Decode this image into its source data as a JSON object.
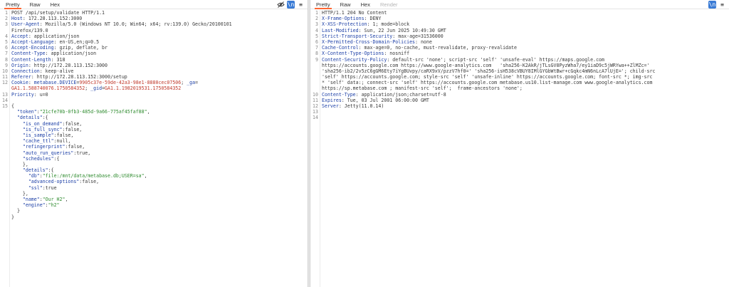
{
  "request": {
    "tabs": [
      {
        "label": "Pretty",
        "active": true
      },
      {
        "label": "Raw"
      },
      {
        "label": "Hex"
      }
    ],
    "tools": [
      {
        "name": "hide-icon",
        "glyph": ""
      },
      {
        "name": "newline-icon",
        "glyph": "\\n"
      },
      {
        "name": "menu-icon",
        "glyph": "≡"
      }
    ]
  },
  "response": {
    "tabs": [
      {
        "label": "Pretty",
        "active": true
      },
      {
        "label": "Raw"
      },
      {
        "label": "Hex"
      },
      {
        "label": "Render",
        "disabled": true
      }
    ]
  },
  "request_lines": [
    {
      "n": "1",
      "parts": [
        {
          "c": "v",
          "t": "POST /api/setup/validate HTTP/1.1"
        }
      ]
    },
    {
      "n": "2",
      "parts": [
        {
          "c": "h",
          "t": "Host"
        },
        {
          "c": "v",
          "t": ": 172.28.113.152:3000"
        }
      ]
    },
    {
      "n": "3",
      "parts": [
        {
          "c": "h",
          "t": "User-Agent"
        },
        {
          "c": "v",
          "t": ": Mozilla/5.0 (Windows NT 10.0; Win64; x64; rv:139.0) Gecko/20100101"
        }
      ]
    },
    {
      "n": "",
      "parts": [
        {
          "c": "v",
          "t": "Firefox/139.0"
        }
      ]
    },
    {
      "n": "4",
      "parts": [
        {
          "c": "h",
          "t": "Accept"
        },
        {
          "c": "v",
          "t": ": application/json"
        }
      ]
    },
    {
      "n": "5",
      "parts": [
        {
          "c": "h",
          "t": "Accept-Language"
        },
        {
          "c": "v",
          "t": ": en-US,en;q=0.5"
        }
      ]
    },
    {
      "n": "6",
      "parts": [
        {
          "c": "h",
          "t": "Accept-Encoding"
        },
        {
          "c": "v",
          "t": ": gzip, deflate, br"
        }
      ]
    },
    {
      "n": "7",
      "parts": [
        {
          "c": "h",
          "t": "Content-Type"
        },
        {
          "c": "v",
          "t": ": application/json"
        }
      ]
    },
    {
      "n": "8",
      "parts": [
        {
          "c": "h",
          "t": "Content-Length"
        },
        {
          "c": "v",
          "t": ": 318"
        }
      ]
    },
    {
      "n": "9",
      "parts": [
        {
          "c": "h",
          "t": "Origin"
        },
        {
          "c": "v",
          "t": ": http://172.28.113.152:3000"
        }
      ]
    },
    {
      "n": "10",
      "parts": [
        {
          "c": "h",
          "t": "Connection"
        },
        {
          "c": "v",
          "t": ": keep-alive"
        }
      ]
    },
    {
      "n": "11",
      "parts": [
        {
          "c": "h",
          "t": "Referer"
        },
        {
          "c": "v",
          "t": ": http://172.28.113.152:3000/setup"
        }
      ]
    },
    {
      "n": "12",
      "parts": [
        {
          "c": "h",
          "t": "Cookie"
        },
        {
          "c": "v",
          "t": ": "
        },
        {
          "c": "ck",
          "t": "metabase.DEVICE"
        },
        {
          "c": "v",
          "t": "="
        },
        {
          "c": "cv",
          "t": "9905c37e-59de-42a3-98e1-8880cec07506"
        },
        {
          "c": "v",
          "t": "; "
        },
        {
          "c": "ck",
          "t": "_ga"
        },
        {
          "c": "v",
          "t": "="
        }
      ]
    },
    {
      "n": "",
      "parts": [
        {
          "c": "cv",
          "t": "GA1.1.588740076.1750584352"
        },
        {
          "c": "v",
          "t": "; "
        },
        {
          "c": "ck",
          "t": "_gid"
        },
        {
          "c": "v",
          "t": "="
        },
        {
          "c": "cv",
          "t": "GA1.1.1982019531.1750584352"
        }
      ]
    },
    {
      "n": "13",
      "parts": [
        {
          "c": "h",
          "t": "Priority"
        },
        {
          "c": "v",
          "t": ": u=0"
        }
      ]
    },
    {
      "n": "14",
      "parts": []
    },
    {
      "n": "15",
      "parts": [
        {
          "c": "jp",
          "t": "{"
        }
      ]
    },
    {
      "n": "",
      "parts": [
        {
          "c": "jp",
          "t": "  "
        },
        {
          "c": "jk",
          "t": "\"token\""
        },
        {
          "c": "jp",
          "t": ":"
        },
        {
          "c": "js",
          "t": "\"21cfe70b-0fb3-485d-9a66-775af45faf88\""
        },
        {
          "c": "jp",
          "t": ","
        }
      ]
    },
    {
      "n": "",
      "parts": [
        {
          "c": "jp",
          "t": "  "
        },
        {
          "c": "jk",
          "t": "\"details\""
        },
        {
          "c": "jp",
          "t": ":{"
        }
      ]
    },
    {
      "n": "",
      "parts": [
        {
          "c": "jp",
          "t": "    "
        },
        {
          "c": "jk",
          "t": "\"is_on_demand\""
        },
        {
          "c": "jp",
          "t": ":false,"
        }
      ]
    },
    {
      "n": "",
      "parts": [
        {
          "c": "jp",
          "t": "    "
        },
        {
          "c": "jk",
          "t": "\"is_full_sync\""
        },
        {
          "c": "jp",
          "t": ":false,"
        }
      ]
    },
    {
      "n": "",
      "parts": [
        {
          "c": "jp",
          "t": "    "
        },
        {
          "c": "jk",
          "t": "\"is_sample\""
        },
        {
          "c": "jp",
          "t": ":false,"
        }
      ]
    },
    {
      "n": "",
      "parts": [
        {
          "c": "jp",
          "t": "    "
        },
        {
          "c": "jk",
          "t": "\"cache_ttl\""
        },
        {
          "c": "jp",
          "t": ":null,"
        }
      ]
    },
    {
      "n": "",
      "parts": [
        {
          "c": "jp",
          "t": "    "
        },
        {
          "c": "jk",
          "t": "\"refingerprint\""
        },
        {
          "c": "jp",
          "t": ":false,"
        }
      ]
    },
    {
      "n": "",
      "parts": [
        {
          "c": "jp",
          "t": "    "
        },
        {
          "c": "jk",
          "t": "\"auto_run_queries\""
        },
        {
          "c": "jp",
          "t": ":true,"
        }
      ]
    },
    {
      "n": "",
      "parts": [
        {
          "c": "jp",
          "t": "    "
        },
        {
          "c": "jk",
          "t": "\"schedules\""
        },
        {
          "c": "jp",
          "t": ":{"
        }
      ]
    },
    {
      "n": "",
      "parts": [
        {
          "c": "jp",
          "t": "    },"
        }
      ]
    },
    {
      "n": "",
      "parts": [
        {
          "c": "jp",
          "t": "    "
        },
        {
          "c": "jk",
          "t": "\"details\""
        },
        {
          "c": "jp",
          "t": ":{"
        }
      ]
    },
    {
      "n": "",
      "parts": [
        {
          "c": "jp",
          "t": "      "
        },
        {
          "c": "jk",
          "t": "\"db\""
        },
        {
          "c": "jp",
          "t": ":"
        },
        {
          "c": "js",
          "t": "\"file:/mnt/data/metabase.db;USER=sa\""
        },
        {
          "c": "jp",
          "t": ","
        }
      ]
    },
    {
      "n": "",
      "parts": [
        {
          "c": "jp",
          "t": "      "
        },
        {
          "c": "jk",
          "t": "\"advanced-options\""
        },
        {
          "c": "jp",
          "t": ":false,"
        }
      ]
    },
    {
      "n": "",
      "parts": [
        {
          "c": "jp",
          "t": "      "
        },
        {
          "c": "jk",
          "t": "\"ssl\""
        },
        {
          "c": "jp",
          "t": ":true"
        }
      ]
    },
    {
      "n": "",
      "parts": [
        {
          "c": "jp",
          "t": "    },"
        }
      ]
    },
    {
      "n": "",
      "parts": [
        {
          "c": "jp",
          "t": "    "
        },
        {
          "c": "jk",
          "t": "\"name\""
        },
        {
          "c": "jp",
          "t": ":"
        },
        {
          "c": "js",
          "t": "\"Our H2\""
        },
        {
          "c": "jp",
          "t": ","
        }
      ]
    },
    {
      "n": "",
      "parts": [
        {
          "c": "jp",
          "t": "    "
        },
        {
          "c": "jk",
          "t": "\"engine\""
        },
        {
          "c": "jp",
          "t": ":"
        },
        {
          "c": "js",
          "t": "\"h2\""
        }
      ]
    },
    {
      "n": "",
      "parts": [
        {
          "c": "jp",
          "t": "  }"
        }
      ]
    },
    {
      "n": "",
      "parts": [
        {
          "c": "jp",
          "t": "}"
        }
      ]
    }
  ],
  "response_lines": [
    {
      "n": "1",
      "parts": [
        {
          "c": "v",
          "t": "HTTP/1.1 204 No Content"
        }
      ]
    },
    {
      "n": "2",
      "parts": [
        {
          "c": "h",
          "t": "X-Frame-Options"
        },
        {
          "c": "v",
          "t": ": DENY"
        }
      ]
    },
    {
      "n": "3",
      "parts": [
        {
          "c": "h",
          "t": "X-XSS-Protection"
        },
        {
          "c": "v",
          "t": ": 1; mode=block"
        }
      ]
    },
    {
      "n": "4",
      "parts": [
        {
          "c": "h",
          "t": "Last-Modified"
        },
        {
          "c": "v",
          "t": ": Sun, 22 Jun 2025 10:49:30 GMT"
        }
      ]
    },
    {
      "n": "5",
      "parts": [
        {
          "c": "h",
          "t": "Strict-Transport-Security"
        },
        {
          "c": "v",
          "t": ": max-age=31536000"
        }
      ]
    },
    {
      "n": "6",
      "parts": [
        {
          "c": "h",
          "t": "X-Permitted-Cross-Domain-Policies"
        },
        {
          "c": "v",
          "t": ": none"
        }
      ]
    },
    {
      "n": "7",
      "parts": [
        {
          "c": "h",
          "t": "Cache-Control"
        },
        {
          "c": "v",
          "t": ": max-age=0, no-cache, must-revalidate, proxy-revalidate"
        }
      ]
    },
    {
      "n": "8",
      "parts": [
        {
          "c": "h",
          "t": "X-Content-Type-Options"
        },
        {
          "c": "v",
          "t": ": nosniff"
        }
      ]
    },
    {
      "n": "9",
      "parts": [
        {
          "c": "h",
          "t": "Content-Security-Policy"
        },
        {
          "c": "v",
          "t": ": default-src 'none'; script-src 'self' 'unsafe-eval' https://maps.google.com"
        }
      ]
    },
    {
      "n": "",
      "parts": [
        {
          "c": "v",
          "t": "https://accounts.google.com https://www.google-analytics.com   'sha256-K2AkR/jTLsGV8PyzWha7/ey1iaD9c5jWRYwa++ZlMZc='"
        }
      ]
    },
    {
      "n": "",
      "parts": [
        {
          "c": "v",
          "t": "'sha256-ib2/2v5zC6gGM6Ety7iYgBUvpy/caRX9xV/pzzV7hf0=' 'sha256-isH538cVBUY8IMlGYGbWtBwr+cGqkc4mN6nLcA7lUjE='; child-src"
        }
      ]
    },
    {
      "n": "",
      "parts": [
        {
          "c": "v",
          "t": "'self' https://accounts.google.com; style-src 'self' 'unsafe-inline' https://accounts.google.com; font-src *; img-src"
        }
      ]
    },
    {
      "n": "",
      "parts": [
        {
          "c": "v",
          "t": "* 'self' data:; connect-src 'self' https://accounts.google.com metabase.us10.list-manage.com www.google-analytics.com"
        }
      ]
    },
    {
      "n": "",
      "parts": [
        {
          "c": "v",
          "t": "https://sp.metabase.com ; manifest-src 'self';  frame-ancestors 'none';"
        }
      ]
    },
    {
      "n": "10",
      "parts": [
        {
          "c": "h",
          "t": "Content-Type"
        },
        {
          "c": "v",
          "t": ": application/json;charset=utf-8"
        }
      ]
    },
    {
      "n": "11",
      "parts": [
        {
          "c": "h",
          "t": "Expires"
        },
        {
          "c": "v",
          "t": ": Tue, 03 Jul 2001 06:00:00 GMT"
        }
      ]
    },
    {
      "n": "12",
      "parts": [
        {
          "c": "h",
          "t": "Server"
        },
        {
          "c": "v",
          "t": ": Jetty(11.0.14)"
        }
      ]
    },
    {
      "n": "13",
      "parts": []
    },
    {
      "n": "14",
      "parts": []
    }
  ]
}
